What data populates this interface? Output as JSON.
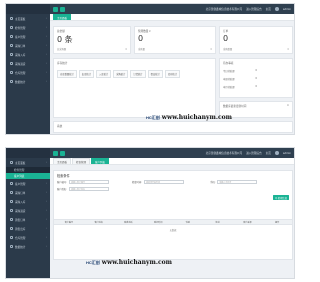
{
  "screen1": {
    "top": {
      "title": "北京慧创鑫城信息技术有限公司",
      "link1": "进入管理后台",
      "item": "主页",
      "user": "admin"
    },
    "sidebar": {
      "items": [
        {
          "label": "主页面板",
          "arrow": "‹"
        },
        {
          "label": "检查管理",
          "arrow": "‹"
        },
        {
          "label": "客户管理",
          "arrow": "‹"
        },
        {
          "label": "采购订单",
          "arrow": "‹"
        },
        {
          "label": "采购入库",
          "arrow": "‹"
        },
        {
          "label": "采购退货",
          "arrow": "‹"
        },
        {
          "label": "仓库管理",
          "arrow": "‹"
        },
        {
          "label": "数据统计",
          "arrow": "‹"
        }
      ]
    },
    "tabs": [
      {
        "label": "主页面板",
        "active": true
      }
    ],
    "cards": [
      {
        "title": "总金额",
        "value": "0 条",
        "sub": "总采购额",
        "right": "0"
      },
      {
        "title": "预测数量 ▾",
        "value": "0",
        "sub": "采购量",
        "right": "0"
      },
      {
        "title": "订单",
        "value": "0",
        "sub": "采购数量",
        "right": "0"
      }
    ],
    "stats": {
      "title": "库存统计",
      "mini_tabs": [
        "仓库数量统计",
        "出库统计",
        "入库统计",
        "采购统计",
        "订货统计",
        "借出统计",
        "库存统计"
      ]
    },
    "side_stats": {
      "title": "待办事项",
      "rows": [
        {
          "k": "今日待处理",
          "v": "0"
        },
        {
          "k": "本周待处理",
          "v": "0"
        },
        {
          "k": "本月待处理",
          "v": "0"
        }
      ]
    },
    "bottom_card": {
      "title": "数据库最新更新时间",
      "icon": "⚙"
    },
    "footer_label": "系统",
    "watermark": {
      "logo": "HC汇创",
      "url": "www.huichanym.com"
    }
  },
  "screen2": {
    "top": {
      "title": "北京慧创鑫城信息技术有限公司",
      "link1": "进入管理后台",
      "item": "主页",
      "user": "admin"
    },
    "sidebar": {
      "items": [
        {
          "label": "主页面板",
          "arrow": "‹",
          "active": false
        },
        {
          "label": "检查管理",
          "arrow": "",
          "active": false,
          "sub": true
        },
        {
          "label": "客户列表",
          "arrow": "",
          "active": true,
          "sub": true
        },
        {
          "label": "客户管理",
          "arrow": "‹"
        },
        {
          "label": "采购订单",
          "arrow": "‹"
        },
        {
          "label": "采购入库",
          "arrow": "‹"
        },
        {
          "label": "采购退货",
          "arrow": "‹"
        },
        {
          "label": "销售订单",
          "arrow": "‹"
        },
        {
          "label": "销售出库",
          "arrow": "‹"
        },
        {
          "label": "仓库管理",
          "arrow": "‹"
        },
        {
          "label": "数据统计",
          "arrow": "‹"
        }
      ]
    },
    "tabs": [
      {
        "label": "主页面板",
        "active": false
      },
      {
        "label": "检查管理",
        "active": false
      },
      {
        "label": "客户列表",
        "active": true
      }
    ],
    "search": {
      "title": "检索条件",
      "fields": [
        {
          "label": "客户编号:",
          "placeholder": "请输入客户编号"
        },
        {
          "label": "检查时间:",
          "placeholder": "请选择开始时间"
        },
        {
          "label": "手机:",
          "placeholder": "请输入手机号"
        },
        {
          "label": "客户姓名:",
          "placeholder": "请输入客户姓名"
        }
      ],
      "button": "Q 检索信息"
    },
    "table": {
      "headers": [
        "客户编号",
        "客户姓名",
        "联系电话",
        "登记时间",
        "性别",
        "地址",
        "客户来源",
        "操作"
      ],
      "empty": "无数据"
    },
    "watermark": {
      "logo": "HC汇创",
      "url": "www.huichanym.com"
    }
  }
}
